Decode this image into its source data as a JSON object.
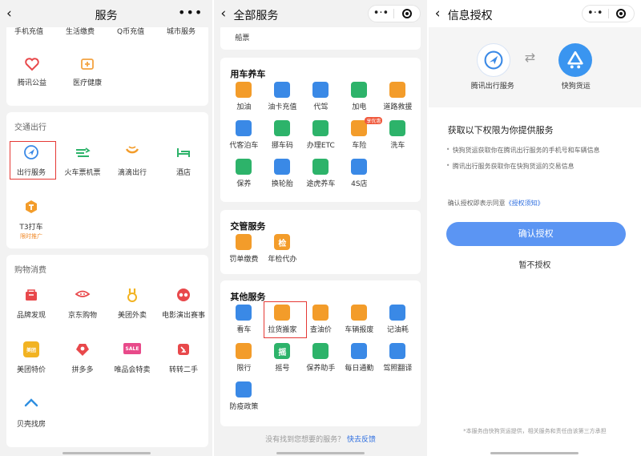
{
  "panel1": {
    "title": "服务",
    "more": "•••",
    "top_cut": [
      "手机充值",
      "生活缴费",
      "Q币充值",
      "城市服务"
    ],
    "top_items": [
      {
        "label": "腾讯公益",
        "icon": "heart-icon",
        "color": "#e8484b"
      },
      {
        "label": "医疗健康",
        "icon": "medical-cross-icon",
        "color": "#f4a340"
      }
    ],
    "transport": {
      "title": "交通出行",
      "items": [
        {
          "label": "出行服务",
          "icon": "navigation-arrow-icon",
          "color": "#3a89e6"
        },
        {
          "label": "火车票机票",
          "icon": "train-plane-icon",
          "color": "#2db36a"
        },
        {
          "label": "滴滴出行",
          "icon": "didi-icon",
          "color": "#f39c2a"
        },
        {
          "label": "酒店",
          "icon": "bed-icon",
          "color": "#2db36a"
        }
      ],
      "t3": {
        "label": "T3打车",
        "sub": "限时推广",
        "icon": "t3-taxi-icon",
        "color": "#f39c2a"
      }
    },
    "shopping": {
      "title": "购物消费",
      "items": [
        {
          "label": "品牌发现",
          "icon": "shop-icon",
          "color": "#e8484b"
        },
        {
          "label": "京东购物",
          "icon": "jd-dog-icon",
          "color": "#e8484b"
        },
        {
          "label": "美团外卖",
          "icon": "meituan-kangaroo-icon",
          "color": "#f2b322"
        },
        {
          "label": "电影演出赛事",
          "icon": "cat-eye-icon",
          "color": "#e8484b"
        },
        {
          "label": "美团特价",
          "icon": "meituan-icon",
          "color": "#f2b322"
        },
        {
          "label": "拼多多",
          "icon": "pinduoduo-icon",
          "color": "#e8484b"
        },
        {
          "label": "唯品会特卖",
          "icon": "vip-sale-icon",
          "color": "#e84a8a"
        },
        {
          "label": "转转二手",
          "icon": "zhuanzhuan-icon",
          "color": "#e8484b"
        },
        {
          "label": "贝壳找房",
          "icon": "beike-house-icon",
          "color": "#2f8fe0"
        }
      ]
    }
  },
  "panel2": {
    "title": "全部服务",
    "top_cut": "船票",
    "car": {
      "title": "用车养车",
      "items": [
        {
          "label": "加油",
          "icon": "fuel-icon",
          "color": "#f39c2a"
        },
        {
          "label": "油卡充值",
          "icon": "fuel-card-icon",
          "color": "#3a89e6"
        },
        {
          "label": "代驾",
          "icon": "steering-wheel-icon",
          "color": "#3a89e6"
        },
        {
          "label": "加电",
          "icon": "charging-icon",
          "color": "#2db36a"
        },
        {
          "label": "道路救援",
          "icon": "traffic-cone-icon",
          "color": "#f39c2a"
        },
        {
          "label": "代客泊车",
          "icon": "parking-icon",
          "color": "#3a89e6"
        },
        {
          "label": "挪车码",
          "icon": "qr-car-icon",
          "color": "#2db36a"
        },
        {
          "label": "办理ETC",
          "icon": "etc-icon",
          "color": "#2db36a"
        },
        {
          "label": "车险",
          "icon": "insurance-icon",
          "color": "#f39c2a",
          "badge": "享优惠"
        },
        {
          "label": "洗车",
          "icon": "car-wash-icon",
          "color": "#2db36a"
        },
        {
          "label": "保养",
          "icon": "oil-can-icon",
          "color": "#2db36a"
        },
        {
          "label": "换轮胎",
          "icon": "tire-icon",
          "color": "#3a89e6"
        },
        {
          "label": "途虎养车",
          "icon": "tuhu-icon",
          "color": "#2db36a"
        },
        {
          "label": "4S店",
          "icon": "4s-store-icon",
          "color": "#3a89e6"
        }
      ]
    },
    "traffic": {
      "title": "交管服务",
      "items": [
        {
          "label": "罚单缴费",
          "icon": "ticket-yuan-icon",
          "color": "#f39c2a"
        },
        {
          "label": "年检代办",
          "icon": "inspection-icon",
          "color": "#f39c2a",
          "glyph": "检"
        }
      ]
    },
    "other": {
      "title": "其他服务",
      "items": [
        {
          "label": "看车",
          "icon": "car-view-icon",
          "color": "#3a89e6"
        },
        {
          "label": "拉货搬家",
          "icon": "truck-icon",
          "color": "#f39c2a"
        },
        {
          "label": "查油价",
          "icon": "price-chart-icon",
          "color": "#f39c2a"
        },
        {
          "label": "车辆报废",
          "icon": "scrap-car-icon",
          "color": "#f39c2a"
        },
        {
          "label": "记油耗",
          "icon": "gauge-icon",
          "color": "#3a89e6"
        },
        {
          "label": "限行",
          "icon": "no-entry-icon",
          "color": "#f39c2a"
        },
        {
          "label": "摇号",
          "icon": "lottery-icon",
          "color": "#2db36a",
          "glyph": "摇"
        },
        {
          "label": "保养助手",
          "icon": "maintenance-clock-icon",
          "color": "#2db36a"
        },
        {
          "label": "每日通勤",
          "icon": "home-commute-icon",
          "color": "#3a89e6"
        },
        {
          "label": "驾照翻译",
          "icon": "license-translate-icon",
          "color": "#3a89e6"
        },
        {
          "label": "防疫政策",
          "icon": "policy-doc-icon",
          "color": "#3a89e6"
        }
      ]
    },
    "footer_text": "没有找到您想要的服务？",
    "footer_link": "快去反馈"
  },
  "panel3": {
    "title": "信息授权",
    "app_left": "腾讯出行服务",
    "app_right": "快狗货运",
    "heading": "获取以下权限为你提供服务",
    "bullets": [
      "快狗货运获取你在腾讯出行服务的手机号和车辆信息",
      "腾讯出行服务获取你在快狗货运的交易信息"
    ],
    "agree_text": "确认授权即表示同意",
    "agree_link": "《授权须知》",
    "confirm": "确认授权",
    "decline": "暂不授权",
    "note": "*本服务由快狗货运提供，相关服务和责任由该第三方承担"
  }
}
